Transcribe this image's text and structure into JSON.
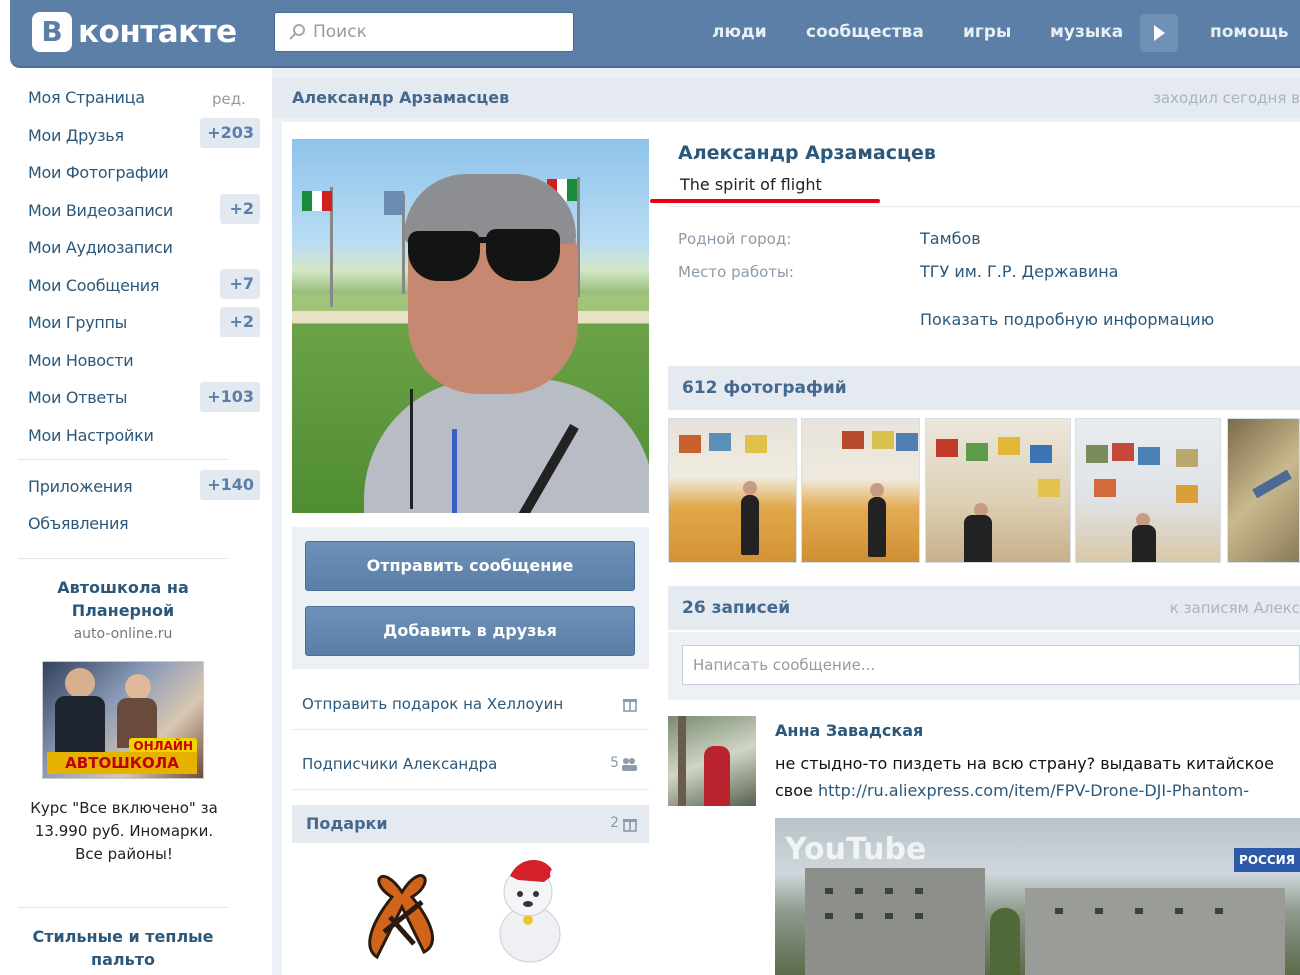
{
  "header": {
    "logo_letter": "В",
    "logo_text": "контакте",
    "search_placeholder": "Поиск",
    "nav": [
      "люди",
      "сообщества",
      "игры",
      "музыка",
      "помощь"
    ]
  },
  "sidebar": {
    "items": [
      {
        "label": "Моя Страница",
        "extra": "ред."
      },
      {
        "label": "Мои Друзья",
        "count": "+203"
      },
      {
        "label": "Мои Фотографии"
      },
      {
        "label": "Мои Видеозаписи",
        "count": "+2"
      },
      {
        "label": "Мои Аудиозаписи"
      },
      {
        "label": "Мои Сообщения",
        "count": "+7"
      },
      {
        "label": "Мои Группы",
        "count": "+2"
      },
      {
        "label": "Мои Новости"
      },
      {
        "label": "Мои Ответы",
        "count": "+103"
      },
      {
        "label": "Мои Настройки"
      },
      {
        "label": "Приложения",
        "count": "+140"
      },
      {
        "label": "Объявления"
      }
    ],
    "ad1": {
      "title": "Автошкола на Планерной",
      "site": "auto-online.ru",
      "banner": "АВТОШКОЛА",
      "tag": "ОНЛАЙН",
      "text": "Курс \"Все включено\" за 13.990 руб. Иномарки. Все районы!"
    },
    "ad2": {
      "title": "Стильные и теплые пальто"
    }
  },
  "page": {
    "head_name": "Александр Арзамасцев",
    "last_seen": "заходил сегодня в"
  },
  "profile": {
    "name": "Александр Арзамасцев",
    "status": "The spirit of flight",
    "hometown_label": "Родной город:",
    "hometown": "Тамбов",
    "work_label": "Место работы:",
    "work": "ТГУ им. Г.Р. Державина",
    "show_more": "Показать подробную информацию",
    "send_message": "Отправить сообщение",
    "add_friend": "Добавить в друзья",
    "gift_link": "Отправить подарок на Хеллоуин",
    "followers_label": "Подписчики Александра",
    "followers_count": "5",
    "gifts_label": "Подарки",
    "gifts_count": "2"
  },
  "photos": {
    "header": "612 фотографий"
  },
  "wall": {
    "header": "26 записей",
    "to_posts": "к записям Алекс",
    "placeholder": "Написать сообщение..."
  },
  "post": {
    "author": "Анна Завадская",
    "text": "не стыдно-то пиздеть на всю страну? выдавать китайское",
    "text2_prefix": "свое",
    "link": "http://ru.aliexpress.com/item/FPV-Drone-DJI-Phantom-",
    "video_logo": "YouTube",
    "video_channel": "РОССИЯ"
  }
}
